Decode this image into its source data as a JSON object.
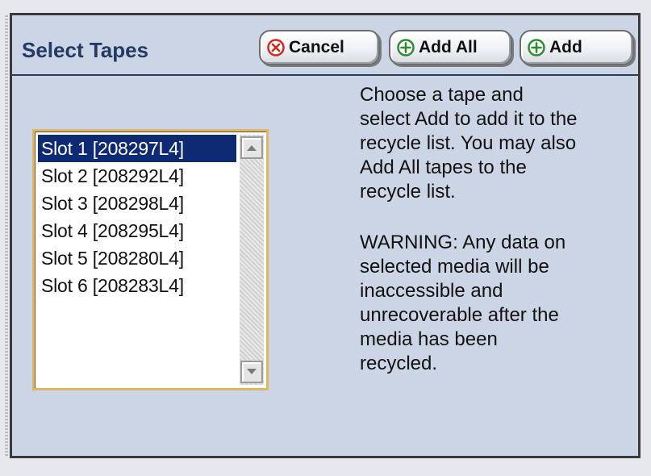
{
  "dialog": {
    "title": "Select Tapes"
  },
  "buttons": {
    "cancel": "Cancel",
    "add_all": "Add All",
    "add": "Add"
  },
  "icons": {
    "cancel": "cancel-circle-icon",
    "add_all": "add-circle-icon",
    "add": "add-circle-icon",
    "scroll_up": "scroll-up-arrow-icon",
    "scroll_down": "scroll-down-arrow-icon"
  },
  "tape_list": {
    "selected_index": 0,
    "items": [
      {
        "label": "Slot 1 [208297L4]"
      },
      {
        "label": "Slot 2 [208292L4]"
      },
      {
        "label": "Slot 3 [208298L4]"
      },
      {
        "label": "Slot 4 [208295L4]"
      },
      {
        "label": "Slot 5 [208280L4]"
      },
      {
        "label": "Slot 6 [208283L4]"
      }
    ]
  },
  "help_text": {
    "lines_1": [
      "Choose a tape and",
      "select Add to add it to the",
      "recycle list. You may also",
      "Add All tapes to the",
      "recycle list."
    ],
    "lines_2": [
      "WARNING: Any data on",
      "selected media will be",
      "inaccessible and",
      "unrecoverable after the",
      "media has been",
      "recycled."
    ]
  },
  "colors": {
    "panel_bg": "#ccd5e5",
    "title_text": "#243a64",
    "selected_row": "#0d2a73",
    "listbox_border": "#e0b760",
    "cancel_icon": "#d9261c",
    "add_icon": "#2e8b2e"
  }
}
